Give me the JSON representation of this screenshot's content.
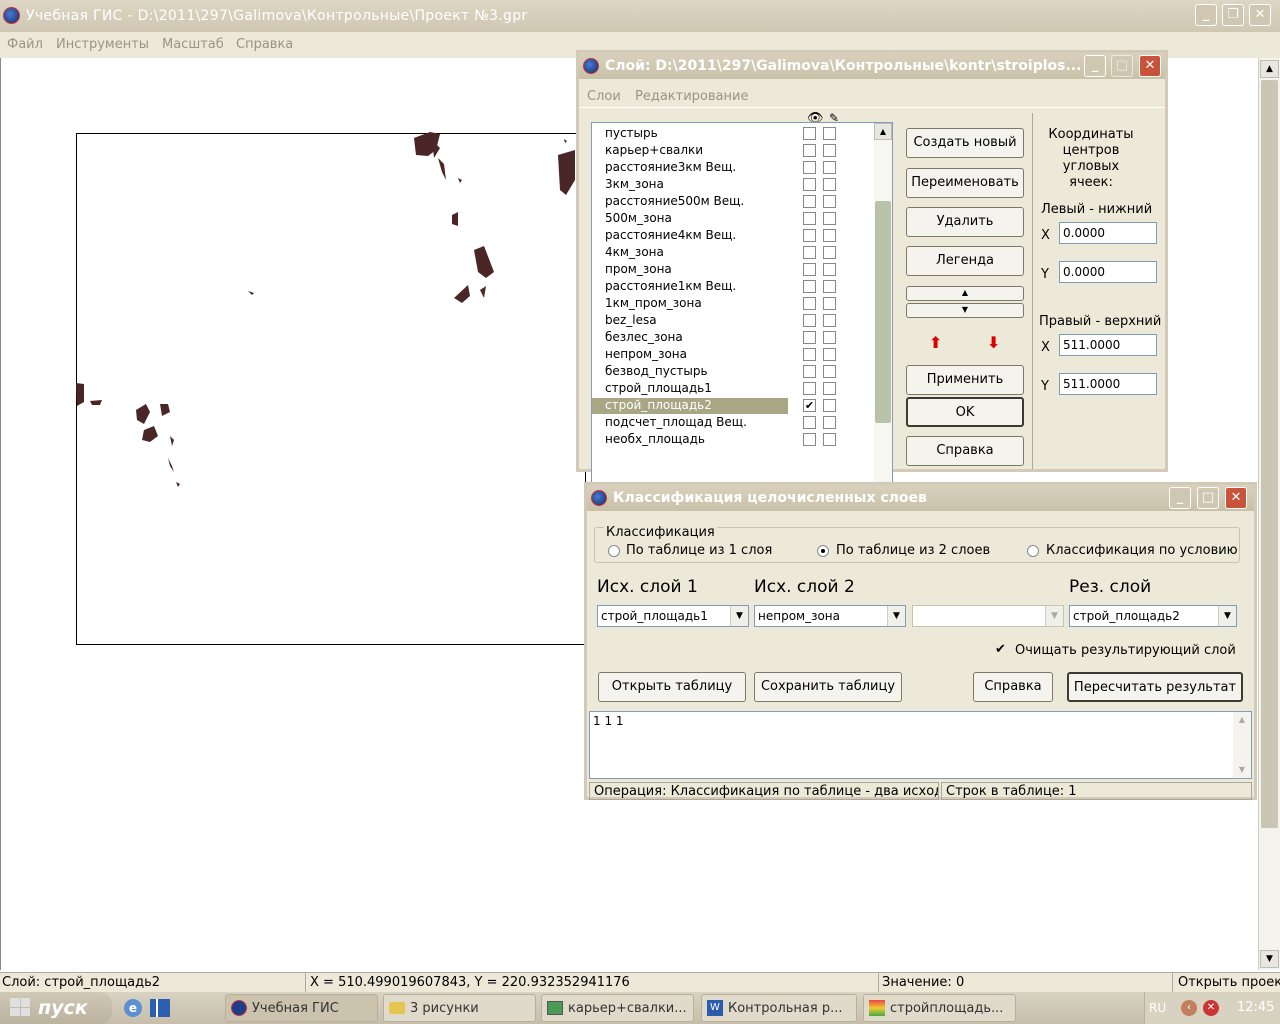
{
  "main_window": {
    "title": "Учебная ГИС - D:\\2011\\297\\Galimova\\Контрольные\\Проект №3.gpr",
    "menu": [
      "Файл",
      "Инструменты",
      "Масштаб",
      "Справка"
    ]
  },
  "layer_dialog": {
    "title": "Слой: D:\\2011\\297\\Galimova\\Контрольные\\kontr\\stroiplos...",
    "menu": [
      "Слои",
      "Редактирование"
    ],
    "layers": [
      {
        "name": "пустырь",
        "visible": false
      },
      {
        "name": "карьер+свалки",
        "visible": false
      },
      {
        "name": "расстояние3км Вещ.",
        "visible": false
      },
      {
        "name": "3км_зона",
        "visible": false
      },
      {
        "name": "расстояние500м Вещ.",
        "visible": false
      },
      {
        "name": "500м_зона",
        "visible": false
      },
      {
        "name": "расстояние4км Вещ.",
        "visible": false
      },
      {
        "name": "4км_зона",
        "visible": false
      },
      {
        "name": "пром_зона",
        "visible": false
      },
      {
        "name": "расстояние1км Вещ.",
        "visible": false
      },
      {
        "name": "1км_пром_зона",
        "visible": false
      },
      {
        "name": "bez_lesa",
        "visible": false
      },
      {
        "name": "безлес_зона",
        "visible": false
      },
      {
        "name": "непром_зона",
        "visible": false
      },
      {
        "name": "безвод_пустырь",
        "visible": false
      },
      {
        "name": "строй_площадь1",
        "visible": false
      },
      {
        "name": "строй_площадь2",
        "visible": true,
        "selected": true
      },
      {
        "name": "подсчет_площад Вещ.",
        "visible": false
      },
      {
        "name": "необх_площадь",
        "visible": false
      }
    ],
    "buttons": {
      "create": "Создать новый",
      "rename": "Переименовать",
      "delete": "Удалить",
      "legend": "Легенда",
      "apply": "Применить",
      "ok": "OK",
      "help": "Справка"
    },
    "coords": {
      "heading": "Координаты центров угловых ячеек:",
      "lower_left_label": "Левый - нижний",
      "upper_right_label": "Правый - верхний",
      "x_label": "X",
      "y_label": "Y",
      "ll_x": "0.0000",
      "ll_y": "0.0000",
      "ur_x": "511.0000",
      "ur_y": "511.0000"
    }
  },
  "class_dialog": {
    "title": "Классификация целочисленных слоев",
    "group_label": "Классификация",
    "radios": [
      {
        "label": "По таблице из 1 слоя",
        "checked": false
      },
      {
        "label": "По таблице из 2 слоев",
        "checked": true
      },
      {
        "label": "Классификация по условию",
        "checked": false
      }
    ],
    "src1_label": "Исх. слой 1",
    "src2_label": "Исх. слой 2",
    "res_label": "Рез. слой",
    "src1_value": "строй_площадь1",
    "src2_value": "непром_зона",
    "src3_value": "",
    "res_value": "строй_площадь2",
    "clear_checkbox": "Очищать результирующий слой",
    "clear_checked": true,
    "open_table": "Открыть таблицу",
    "save_table": "Сохранить таблицу",
    "help": "Справка",
    "recalc": "Пересчитать результат",
    "table_text": "1 1 1",
    "status_op": "Операция: Классификация по таблице - два исходнь",
    "status_rows": "Строк в таблице: 1"
  },
  "status": {
    "layer": "Слой: строй_площадь2",
    "coords": "X = 510.499019607843, Y = 220.932352941176",
    "value": "Значение: 0",
    "hint": "Открыть проек"
  },
  "taskbar": {
    "start": "пуск",
    "tasks": [
      "Учебная ГИС",
      "3 рисунки",
      "карьер+свалки...",
      "Контрольная р...",
      "стройплощадь..."
    ],
    "lang": "RU",
    "time": "12:45"
  },
  "colors": {
    "map_feature": "#4a2626",
    "selection": "#a9a686"
  }
}
